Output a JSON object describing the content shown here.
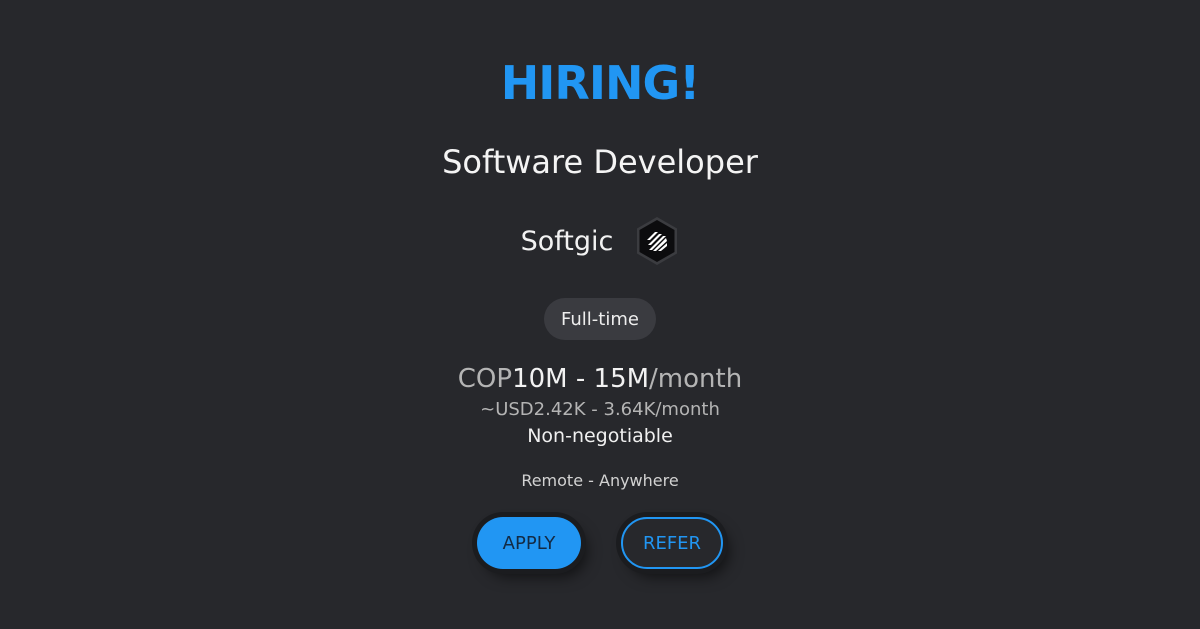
{
  "headline": "HIRING!",
  "job": {
    "title": "Software Developer",
    "company": "Softgic",
    "employment_type": "Full-time"
  },
  "salary": {
    "currency": "COP",
    "range": "10M - 15M",
    "period": "/month",
    "converted": "~USD2.42K - 3.64K/month",
    "note": "Non-negotiable"
  },
  "location": "Remote - Anywhere",
  "actions": {
    "apply_label": "APPLY",
    "refer_label": "REFER"
  },
  "colors": {
    "background": "#27282c",
    "accent": "#2196f3",
    "badge": "#3a3b40"
  },
  "icons": {
    "company_logo": "softgic-logo-icon"
  }
}
